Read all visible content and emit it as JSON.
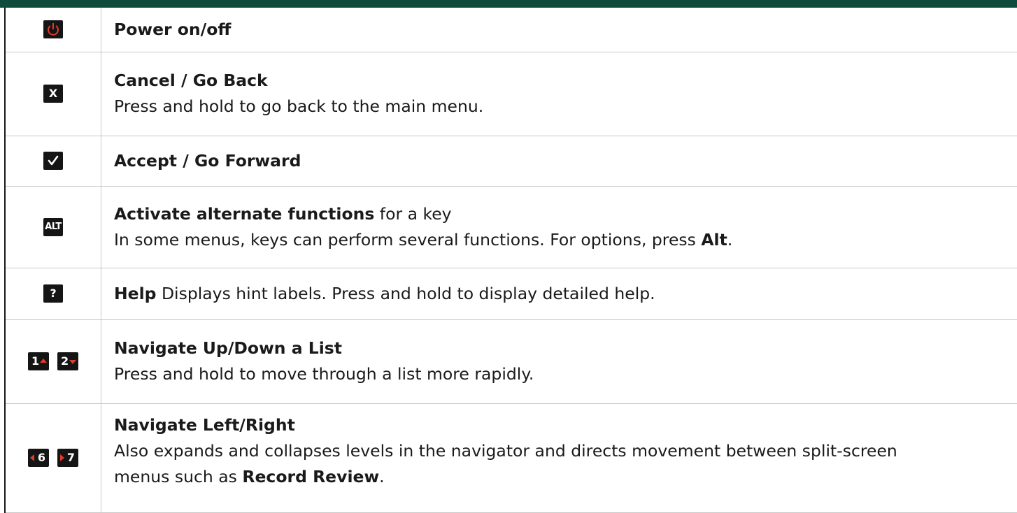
{
  "colors": {
    "header_bar": "#0f4a3c",
    "key_bg": "#151515",
    "accent_red": "#e03c2a"
  },
  "rows": [
    {
      "icon": "power-icon",
      "title": "Power on/off"
    },
    {
      "icon": "close-icon",
      "key_label": "X",
      "title": "Cancel / Go Back",
      "desc": "Press and hold to go back to the main menu."
    },
    {
      "icon": "check-icon",
      "title": "Accept / Go Forward"
    },
    {
      "icon": "alt-key-icon",
      "key_label": "ALT",
      "title": "Activate alternate functions",
      "title_suffix": " for a key",
      "desc_pre": "In some menus, keys can perform several functions. For options, press ",
      "desc_bold": "Alt",
      "desc_post": "."
    },
    {
      "icon": "help-icon",
      "key_label": "?",
      "title": "Help",
      "title_suffix": " Displays hint labels. Press and hold to display detailed help."
    },
    {
      "icon": "up-down-keys-icon",
      "key1": "1",
      "key2": "2",
      "title": "Navigate Up/Down a List",
      "desc": "Press and hold to move through a list more rapidly."
    },
    {
      "icon": "left-right-keys-icon",
      "key1": "6",
      "key2": "7",
      "title": "Navigate Left/Right",
      "desc_line1": "Also expands and collapses levels in the navigator and directs movement between split-screen",
      "desc_line2_pre": "menus such as ",
      "desc_line2_bold": "Record Review",
      "desc_line2_post": "."
    }
  ]
}
